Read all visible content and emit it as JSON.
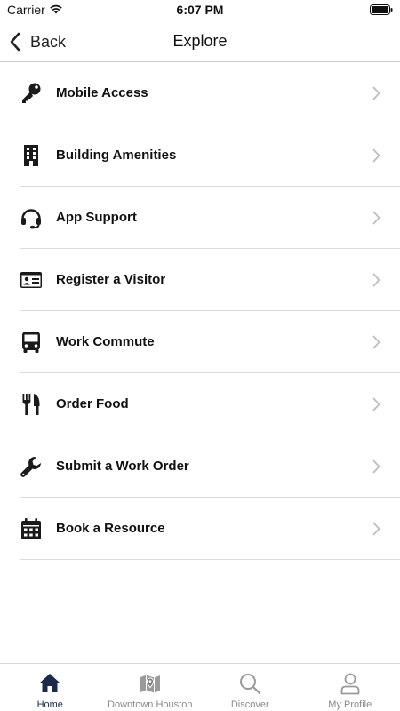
{
  "status": {
    "carrier": "Carrier",
    "time": "6:07 PM"
  },
  "nav": {
    "back_label": "Back",
    "title": "Explore"
  },
  "menu": [
    {
      "label": "Mobile Access",
      "icon": "key-icon"
    },
    {
      "label": "Building Amenities",
      "icon": "building-icon"
    },
    {
      "label": "App Support",
      "icon": "headset-icon"
    },
    {
      "label": "Register a Visitor",
      "icon": "id-card-icon"
    },
    {
      "label": "Work Commute",
      "icon": "bus-icon"
    },
    {
      "label": "Order Food",
      "icon": "utensils-icon"
    },
    {
      "label": "Submit a Work Order",
      "icon": "wrench-icon"
    },
    {
      "label": "Book a Resource",
      "icon": "calendar-icon"
    }
  ],
  "tabs": [
    {
      "label": "Home",
      "icon": "home-icon",
      "active": true
    },
    {
      "label": "Downtown Houston",
      "icon": "map-icon",
      "active": false
    },
    {
      "label": "Discover",
      "icon": "search-icon",
      "active": false
    },
    {
      "label": "My Profile",
      "icon": "person-icon",
      "active": false
    }
  ],
  "colors": {
    "active_tab": "#1b2a4a",
    "inactive_tab": "#8a8a8a",
    "icon": "#1a1a1a"
  }
}
